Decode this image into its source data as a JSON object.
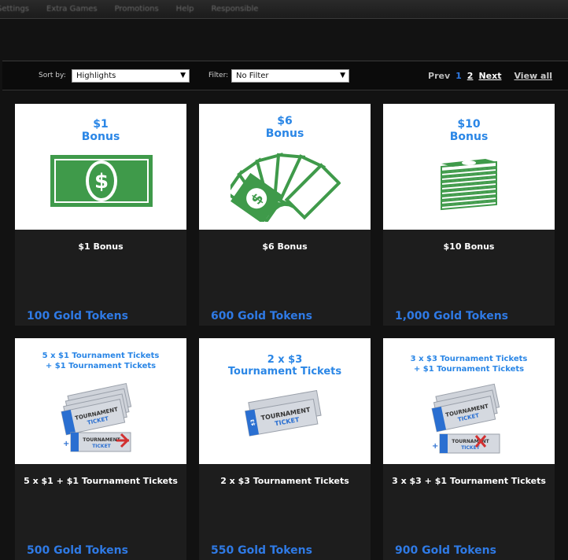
{
  "topnav": {
    "items": [
      "Settings",
      "Extra Games",
      "Promotions",
      "Help",
      "Responsible"
    ]
  },
  "toolbar": {
    "sort_label": "Sort by:",
    "sort_value": "Highlights",
    "filter_label": "Filter:",
    "filter_value": "No Filter",
    "pager": {
      "prev": "Prev",
      "page1": "1",
      "page2": "2",
      "next": "Next",
      "view_all": "View all"
    }
  },
  "cards": [
    {
      "img_line1": "$1",
      "img_line2": "Bonus",
      "name": "$1 Bonus",
      "price": "100 Gold Tokens"
    },
    {
      "img_line1": "$6",
      "img_line2": "Bonus",
      "name": "$6 Bonus",
      "price": "600 Gold Tokens"
    },
    {
      "img_line1": "$10",
      "img_line2": "Bonus",
      "name": "$10 Bonus",
      "price": "1,000 Gold Tokens"
    },
    {
      "img_line1": "5 x $1 Tournament Tickets",
      "img_line2": "+ $1 Tournament Tickets",
      "name": "5 x $1 + $1 Tournament Tickets",
      "price": "500 Gold Tokens"
    },
    {
      "img_line1": "2 x $3",
      "img_line2": "Tournament Tickets",
      "name": "2 x $3 Tournament Tickets",
      "price": "550 Gold Tokens"
    },
    {
      "img_line1": "3 x $3 Tournament Tickets",
      "img_line2": "+ $1 Tournament Tickets",
      "name": "3 x $3 + $1 Tournament Tickets",
      "price": "900 Gold Tokens"
    }
  ],
  "ticket": {
    "word1": "TOURNAMENT",
    "word2": "TICKET",
    "stub_1": "$1",
    "stub_3": "$3",
    "plus": "+"
  },
  "colors": {
    "accent_blue": "#2f7ae5",
    "money_green": "#3f9a4a",
    "card_bg": "#1d1d1d"
  }
}
